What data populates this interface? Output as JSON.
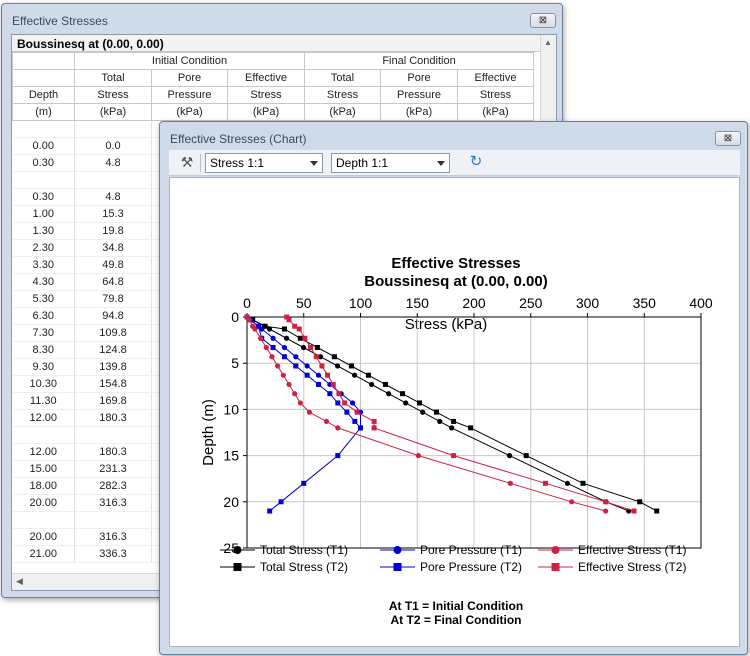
{
  "table_window": {
    "title": "Effective Stresses",
    "close_glyph": "⊠",
    "caption": "Boussinesq at (0.00, 0.00)",
    "group_initial": "Initial Condition",
    "group_final": "Final Condition",
    "hdr1": [
      "Total",
      "Pore",
      "Effective",
      "Total",
      "Pore",
      "Effective"
    ],
    "hdr2": [
      "Depth",
      "Stress",
      "Pressure",
      "Stress",
      "Stress",
      "Pressure",
      "Stress"
    ],
    "hdr3": [
      "(m)",
      "(kPa)",
      "(kPa)",
      "(kPa)",
      "(kPa)",
      "(kPa)",
      "(kPa)"
    ],
    "rows": [
      [
        "",
        ""
      ],
      [
        "0.00",
        "0.0"
      ],
      [
        "0.30",
        "4.8"
      ],
      [
        "",
        ""
      ],
      [
        "0.30",
        "4.8"
      ],
      [
        "1.00",
        "15.3"
      ],
      [
        "1.30",
        "19.8"
      ],
      [
        "2.30",
        "34.8"
      ],
      [
        "3.30",
        "49.8"
      ],
      [
        "4.30",
        "64.8"
      ],
      [
        "5.30",
        "79.8"
      ],
      [
        "6.30",
        "94.8"
      ],
      [
        "7.30",
        "109.8"
      ],
      [
        "8.30",
        "124.8"
      ],
      [
        "9.30",
        "139.8"
      ],
      [
        "10.30",
        "154.8"
      ],
      [
        "11.30",
        "169.8"
      ],
      [
        "12.00",
        "180.3"
      ],
      [
        "",
        ""
      ],
      [
        "12.00",
        "180.3"
      ],
      [
        "15.00",
        "231.3"
      ],
      [
        "18.00",
        "282.3"
      ],
      [
        "20.00",
        "316.3"
      ],
      [
        "",
        ""
      ],
      [
        "20.00",
        "316.3"
      ],
      [
        "21.00",
        "336.3"
      ]
    ]
  },
  "chart_window": {
    "title": "Effective Stresses (Chart)",
    "close_glyph": "⊠",
    "tool_glyph": "⚒",
    "stress_dropdown": "Stress 1:1",
    "depth_dropdown": "Depth 1:1",
    "refresh_glyph": "↻"
  },
  "chart_data": {
    "type": "line",
    "title": "Effective Stresses",
    "subtitle": "Boussinesq at (0.00, 0.00)",
    "xlabel": "Stress (kPa)",
    "ylabel": "Depth (m)",
    "xlim": [
      0,
      400
    ],
    "ylim": [
      0,
      25
    ],
    "x_ticks": [
      0,
      50,
      100,
      150,
      200,
      250,
      300,
      350,
      400
    ],
    "y_ticks": [
      0,
      5,
      10,
      15,
      20,
      25
    ],
    "x_axis_position": "top",
    "y_inverted": true,
    "grid": true,
    "legend_position": "bottom",
    "series": [
      {
        "name": "Total Stress (T1)",
        "color": "#000000",
        "marker": "circle",
        "points": [
          [
            0,
            0
          ],
          [
            4.8,
            0.3
          ],
          [
            15.3,
            1
          ],
          [
            19.8,
            1.3
          ],
          [
            34.8,
            2.3
          ],
          [
            49.8,
            3.3
          ],
          [
            64.8,
            4.3
          ],
          [
            79.8,
            5.3
          ],
          [
            94.8,
            6.3
          ],
          [
            109.8,
            7.3
          ],
          [
            124.8,
            8.3
          ],
          [
            139.8,
            9.3
          ],
          [
            154.8,
            10.3
          ],
          [
            169.8,
            11.3
          ],
          [
            180.3,
            12
          ],
          [
            231.3,
            15
          ],
          [
            282.3,
            18
          ],
          [
            316.3,
            20
          ],
          [
            336.3,
            21
          ]
        ]
      },
      {
        "name": "Total Stress (T2)",
        "color": "#000000",
        "marker": "square",
        "points": [
          [
            0,
            0
          ],
          [
            5,
            0.3
          ],
          [
            16,
            1
          ],
          [
            33,
            1.3
          ],
          [
            47,
            2.3
          ],
          [
            62,
            3.3
          ],
          [
            77,
            4.3
          ],
          [
            92,
            5.3
          ],
          [
            107,
            6.3
          ],
          [
            122,
            7.3
          ],
          [
            137,
            8.3
          ],
          [
            152,
            9.3
          ],
          [
            167,
            10.3
          ],
          [
            182,
            11.3
          ],
          [
            197,
            12
          ],
          [
            246,
            15
          ],
          [
            296,
            18
          ],
          [
            346,
            20
          ],
          [
            361,
            21
          ]
        ]
      },
      {
        "name": "Pore Pressure (T1)",
        "color": "#0000d0",
        "marker": "circle",
        "points": [
          [
            0,
            0
          ],
          [
            3,
            0.3
          ],
          [
            10,
            1
          ],
          [
            13,
            1.3
          ],
          [
            23,
            2.3
          ],
          [
            33,
            3.3
          ],
          [
            43,
            4.3
          ],
          [
            53,
            5.3
          ],
          [
            63,
            6.3
          ],
          [
            73,
            7.3
          ],
          [
            83,
            8.3
          ],
          [
            93,
            9.3
          ],
          [
            100,
            10.3
          ],
          [
            100,
            12
          ]
        ]
      },
      {
        "name": "Pore Pressure (T2)",
        "color": "#0000d0",
        "marker": "square",
        "points": [
          [
            0,
            0
          ],
          [
            3,
            0.3
          ],
          [
            10,
            1
          ],
          [
            13,
            2.3
          ],
          [
            23,
            3.3
          ],
          [
            33,
            4.3
          ],
          [
            43,
            5.3
          ],
          [
            53,
            6.3
          ],
          [
            63,
            7.3
          ],
          [
            73,
            8.3
          ],
          [
            80,
            9.3
          ],
          [
            88,
            10.3
          ],
          [
            95,
            11.3
          ],
          [
            100,
            12
          ],
          [
            80,
            15
          ],
          [
            50,
            18
          ],
          [
            30,
            20
          ],
          [
            20,
            21
          ]
        ]
      },
      {
        "name": "Effective Stress (T1)",
        "color": "#cc2244",
        "marker": "circle",
        "points": [
          [
            0,
            0
          ],
          [
            2,
            0.3
          ],
          [
            5,
            1
          ],
          [
            7,
            1.3
          ],
          [
            12,
            2.3
          ],
          [
            17,
            3.3
          ],
          [
            22,
            4.3
          ],
          [
            27,
            5.3
          ],
          [
            32,
            6.3
          ],
          [
            37,
            7.3
          ],
          [
            42,
            8.3
          ],
          [
            47,
            9.3
          ],
          [
            55,
            10.3
          ],
          [
            70,
            11.3
          ],
          [
            80,
            12
          ],
          [
            151,
            15
          ],
          [
            232,
            18
          ],
          [
            286,
            20
          ],
          [
            316,
            21
          ]
        ]
      },
      {
        "name": "Effective Stress (T2)",
        "color": "#cc2244",
        "marker": "square",
        "points": [
          [
            35,
            0
          ],
          [
            37,
            0.3
          ],
          [
            42,
            1
          ],
          [
            46,
            1.3
          ],
          [
            51,
            2.3
          ],
          [
            56,
            3.3
          ],
          [
            61,
            4.3
          ],
          [
            66,
            5.3
          ],
          [
            71,
            6.3
          ],
          [
            76,
            7.3
          ],
          [
            81,
            8.3
          ],
          [
            86,
            9.3
          ],
          [
            97,
            10.3
          ],
          [
            112,
            11.3
          ],
          [
            112,
            12
          ],
          [
            182,
            15
          ],
          [
            263,
            18
          ],
          [
            316,
            20
          ],
          [
            341,
            21
          ]
        ]
      }
    ],
    "notes": [
      "At T1 = Initial Condition",
      "At T2 = Final Condition"
    ]
  }
}
